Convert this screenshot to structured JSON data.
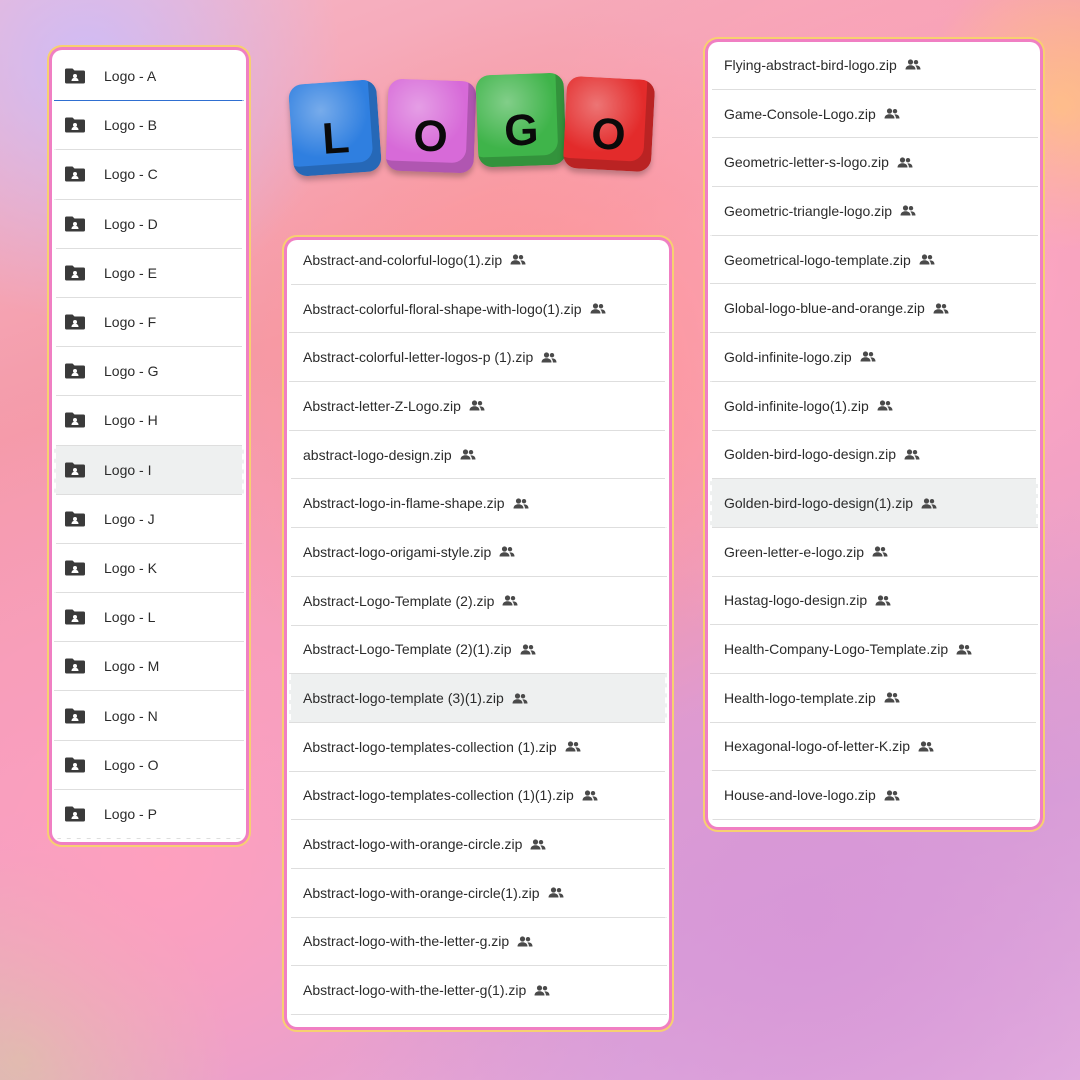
{
  "banner": {
    "letters": [
      "L",
      "O",
      "G",
      "O"
    ],
    "colors": [
      "#2f7fe0",
      "#d76ad8",
      "#3fb44a",
      "#e32b2b"
    ]
  },
  "folders": [
    {
      "label": "Logo - A"
    },
    {
      "label": "Logo - B"
    },
    {
      "label": "Logo - C"
    },
    {
      "label": "Logo - D"
    },
    {
      "label": "Logo - E"
    },
    {
      "label": "Logo - F"
    },
    {
      "label": "Logo - G"
    },
    {
      "label": "Logo - H"
    },
    {
      "label": "Logo - I"
    },
    {
      "label": "Logo - J"
    },
    {
      "label": "Logo - K"
    },
    {
      "label": "Logo - L"
    },
    {
      "label": "Logo - M"
    },
    {
      "label": "Logo - N"
    },
    {
      "label": "Logo - O"
    },
    {
      "label": "Logo - P"
    }
  ],
  "middle_files": [
    "Abstract-and-colorful-logo(1).zip",
    "Abstract-colorful-floral-shape-with-logo(1).zip",
    "Abstract-colorful-letter-logos-p (1).zip",
    "Abstract-letter-Z-Logo.zip",
    "abstract-logo-design.zip",
    "Abstract-logo-in-flame-shape.zip",
    "Abstract-logo-origami-style.zip",
    "Abstract-Logo-Template (2).zip",
    "Abstract-Logo-Template (2)(1).zip",
    "Abstract-logo-template (3)(1).zip",
    "Abstract-logo-templates-collection (1).zip",
    "Abstract-logo-templates-collection (1)(1).zip",
    "Abstract-logo-with-orange-circle.zip",
    "Abstract-logo-with-orange-circle(1).zip",
    "Abstract-logo-with-the-letter-g.zip",
    "Abstract-logo-with-the-letter-g(1).zip"
  ],
  "right_files": [
    "Flying-abstract-bird-logo.zip",
    "Game-Console-Logo.zip",
    "Geometric-letter-s-logo.zip",
    "Geometric-triangle-logo.zip",
    "Geometrical-logo-template.zip",
    "Global-logo-blue-and-orange.zip",
    "Gold-infinite-logo.zip",
    "Gold-infinite-logo(1).zip",
    "Golden-bird-logo-design.zip",
    "Golden-bird-logo-design(1).zip",
    "Green-letter-e-logo.zip",
    "Hastag-logo-design.zip",
    "Health-Company-Logo-Template.zip",
    "Health-logo-template.zip",
    "Hexagonal-logo-of-letter-K.zip",
    "House-and-love-logo.zip"
  ],
  "selected": {
    "folder_index": 8,
    "middle_index": 9,
    "right_index": 9
  },
  "icons": {
    "folder": "shared-folder-icon",
    "shared": "people-icon"
  }
}
